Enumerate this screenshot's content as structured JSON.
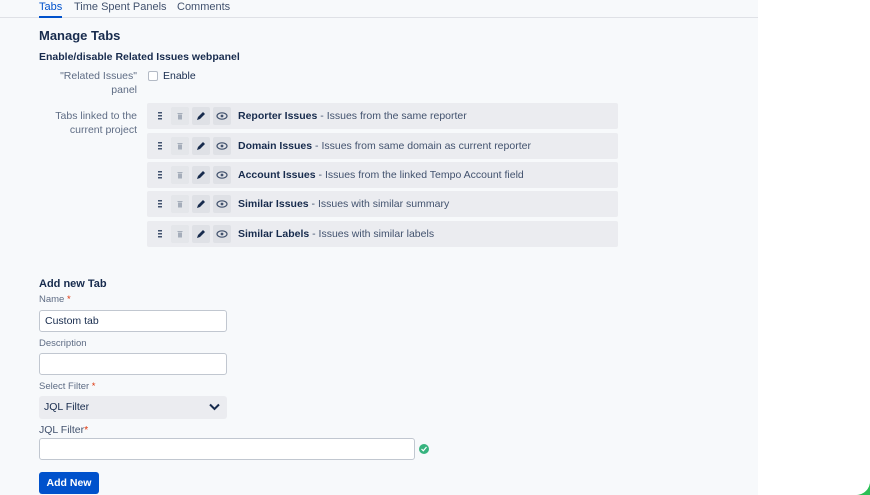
{
  "tabs": [
    {
      "label": "Tabs",
      "active": true
    },
    {
      "label": "Time Spent Panels",
      "active": false
    },
    {
      "label": "Comments",
      "active": false
    }
  ],
  "manage": {
    "title": "Manage Tabs",
    "section_title": "Enable/disable Related Issues webpanel",
    "related_label": "\"Related Issues\" panel",
    "enable_label": "Enable",
    "tabs_linked_label": "Tabs linked to the current project",
    "rows": [
      {
        "name": "Reporter Issues",
        "desc": " - Issues from the same reporter"
      },
      {
        "name": "Domain Issues",
        "desc": " - Issues from same domain as current reporter"
      },
      {
        "name": "Account Issues",
        "desc": " - Issues from the linked Tempo Account field"
      },
      {
        "name": "Similar Issues",
        "desc": " - Issues with similar summary"
      },
      {
        "name": "Similar Labels",
        "desc": " - Issues with similar labels"
      }
    ]
  },
  "add": {
    "title": "Add new Tab",
    "name_label": "Name",
    "name_value": "Custom tab",
    "description_label": "Description",
    "description_value": "",
    "filter_label": "Select Filter",
    "filter_value": "JQL Filter",
    "jql_label": "JQL Filter",
    "jql_value": "",
    "required_mark": "*",
    "button": "Add New"
  },
  "colors": {
    "accent": "#0052cc",
    "success": "#36b37e",
    "frame": "#2bbf55"
  }
}
